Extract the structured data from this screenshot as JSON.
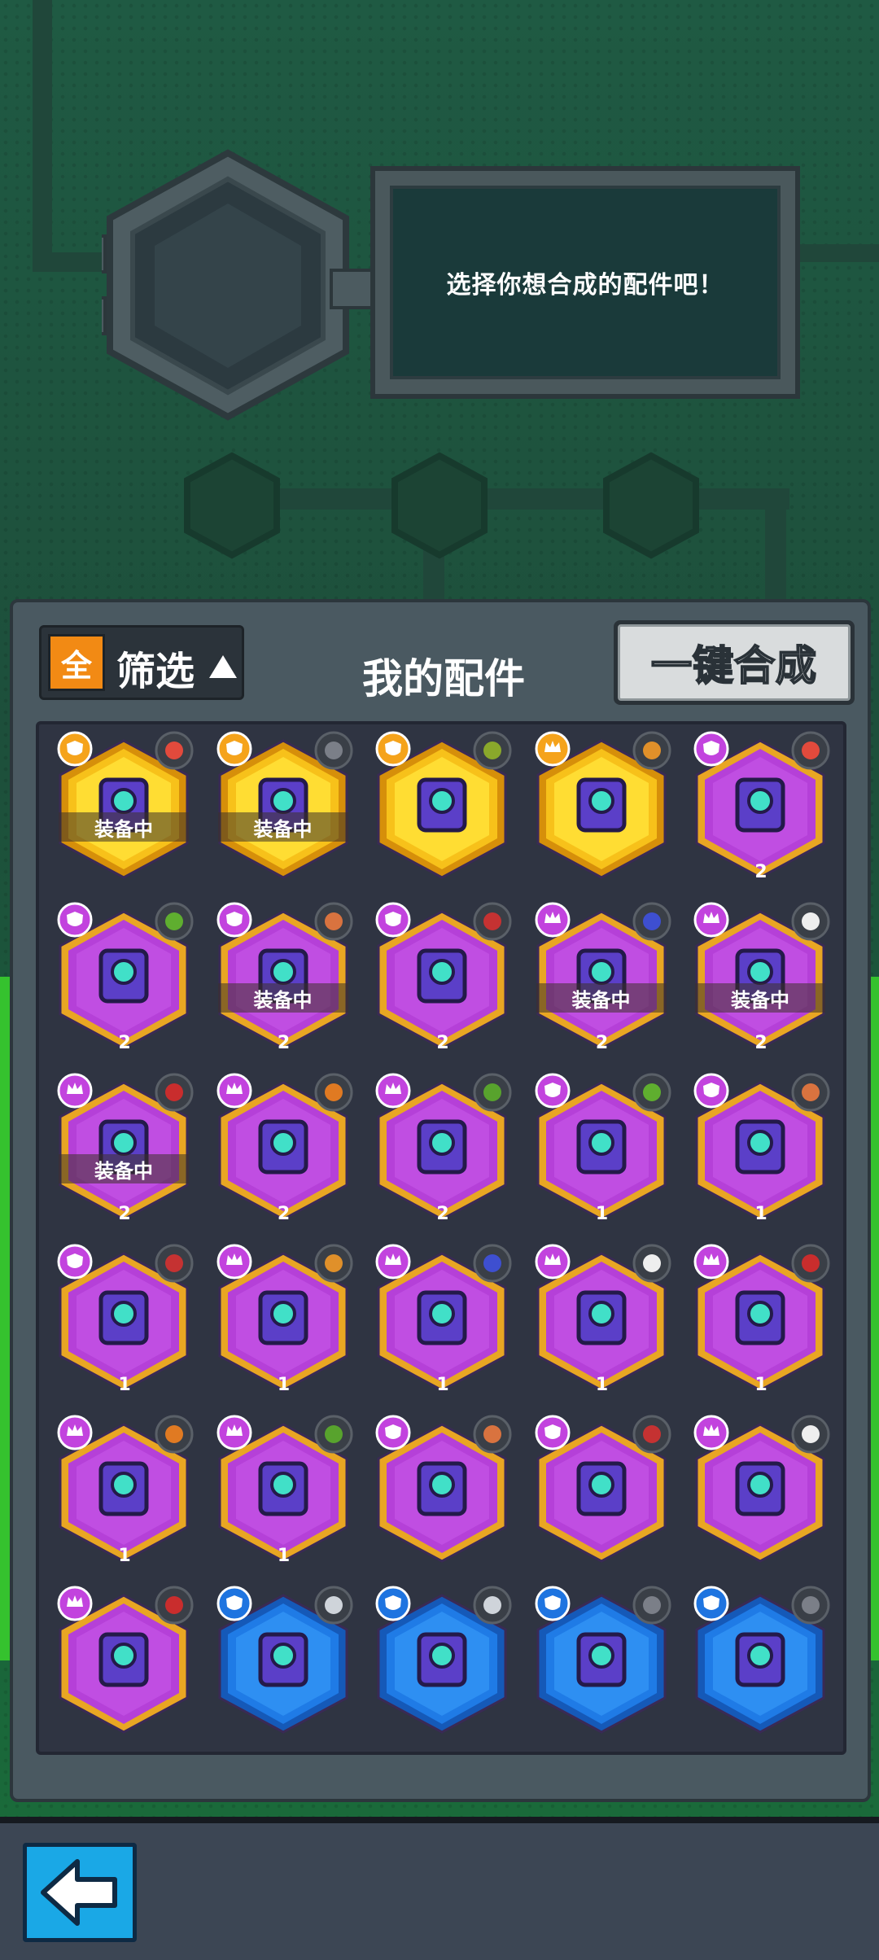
{
  "header": {
    "prompt": "选择你想合成的配件吧！"
  },
  "panel": {
    "title": "我的配件",
    "filter": {
      "all_label": "全",
      "label": "筛选"
    },
    "merge_button": "一键合成"
  },
  "colors": {
    "gold": "#f7c11a",
    "purple": "#b540d8",
    "blue": "#1f7be6",
    "panel": "#4a5961",
    "grid": "#2f3442"
  },
  "items": [
    {
      "rarity": "gold",
      "badge": "shield",
      "accessory": "rocket-icon",
      "equipped": "装备中",
      "count": ""
    },
    {
      "rarity": "gold",
      "badge": "shield",
      "accessory": "gear-icon",
      "equipped": "装备中",
      "count": ""
    },
    {
      "rarity": "gold",
      "badge": "shield",
      "accessory": "spore-icon",
      "equipped": "",
      "count": ""
    },
    {
      "rarity": "gold",
      "badge": "crown",
      "accessory": "drill-icon",
      "equipped": "",
      "count": ""
    },
    {
      "rarity": "purple",
      "badge": "shield",
      "accessory": "rocket-icon",
      "equipped": "",
      "count": "2"
    },
    {
      "rarity": "purple",
      "badge": "shield",
      "accessory": "melon-icon",
      "equipped": "",
      "count": "2"
    },
    {
      "rarity": "purple",
      "badge": "shield",
      "accessory": "brick-icon",
      "equipped": "装备中",
      "count": "2"
    },
    {
      "rarity": "purple",
      "badge": "shield",
      "accessory": "boomerang-icon",
      "equipped": "",
      "count": "2"
    },
    {
      "rarity": "purple",
      "badge": "crown",
      "accessory": "cone-icon",
      "equipped": "装备中",
      "count": "2"
    },
    {
      "rarity": "purple",
      "badge": "crown",
      "accessory": "soccer-icon",
      "equipped": "装备中",
      "count": "2"
    },
    {
      "rarity": "purple",
      "badge": "crown",
      "accessory": "tape-icon",
      "equipped": "装备中",
      "count": "2"
    },
    {
      "rarity": "purple",
      "badge": "crown",
      "accessory": "fox-icon",
      "equipped": "",
      "count": "2"
    },
    {
      "rarity": "purple",
      "badge": "crown",
      "accessory": "bottle-icon",
      "equipped": "",
      "count": "2"
    },
    {
      "rarity": "purple",
      "badge": "shield",
      "accessory": "melon-icon",
      "equipped": "",
      "count": "1"
    },
    {
      "rarity": "purple",
      "badge": "shield",
      "accessory": "brick-icon",
      "equipped": "",
      "count": "1"
    },
    {
      "rarity": "purple",
      "badge": "shield",
      "accessory": "boomerang-icon",
      "equipped": "",
      "count": "1"
    },
    {
      "rarity": "purple",
      "badge": "crown",
      "accessory": "drill-icon",
      "equipped": "",
      "count": "1"
    },
    {
      "rarity": "purple",
      "badge": "crown",
      "accessory": "cone-icon",
      "equipped": "",
      "count": "1"
    },
    {
      "rarity": "purple",
      "badge": "crown",
      "accessory": "soccer-icon",
      "equipped": "",
      "count": "1"
    },
    {
      "rarity": "purple",
      "badge": "crown",
      "accessory": "tape-icon",
      "equipped": "",
      "count": "1"
    },
    {
      "rarity": "purple",
      "badge": "crown",
      "accessory": "fox-icon",
      "equipped": "",
      "count": "1"
    },
    {
      "rarity": "purple",
      "badge": "crown",
      "accessory": "bottle-icon",
      "equipped": "",
      "count": "1"
    },
    {
      "rarity": "purple",
      "badge": "shield",
      "accessory": "brick-icon",
      "equipped": "",
      "count": ""
    },
    {
      "rarity": "purple",
      "badge": "shield",
      "accessory": "boomerang-icon",
      "equipped": "",
      "count": ""
    },
    {
      "rarity": "purple",
      "badge": "crown",
      "accessory": "soccer-icon",
      "equipped": "",
      "count": ""
    },
    {
      "rarity": "purple",
      "badge": "crown",
      "accessory": "tape-icon",
      "equipped": "",
      "count": ""
    },
    {
      "rarity": "blue",
      "badge": "shield",
      "accessory": "feather-icon",
      "equipped": "",
      "count": ""
    },
    {
      "rarity": "blue",
      "badge": "shield",
      "accessory": "feather-icon",
      "equipped": "",
      "count": ""
    },
    {
      "rarity": "blue",
      "badge": "shield",
      "accessory": "gear-icon",
      "equipped": "",
      "count": ""
    },
    {
      "rarity": "blue",
      "badge": "shield",
      "accessory": "gear-icon",
      "equipped": "",
      "count": ""
    }
  ]
}
